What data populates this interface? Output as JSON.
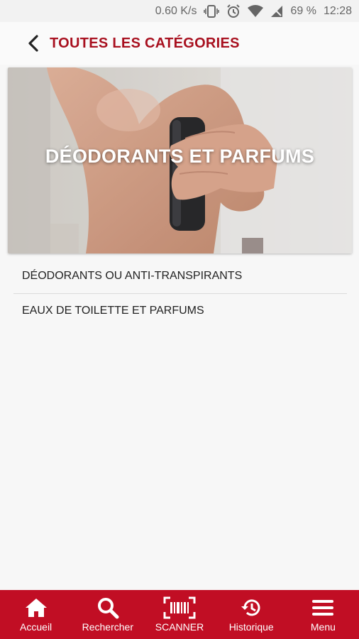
{
  "status_bar": {
    "speed": "0.60 K/s",
    "battery": "69 %",
    "time": "12:28",
    "icons": [
      "vibrate-icon",
      "alarm-icon",
      "wifi-icon",
      "signal-icon"
    ]
  },
  "header": {
    "back_icon": "chevron-left-icon",
    "title": "TOUTES LES CATÉGORIES"
  },
  "hero": {
    "title": "DÉODORANTS ET PARFUMS"
  },
  "list": {
    "items": [
      {
        "label": "DÉODORANTS OU ANTI-TRANSPIRANTS"
      },
      {
        "label": "EAUX DE TOILETTE ET PARFUMS"
      }
    ]
  },
  "bottom_nav": {
    "items": [
      {
        "label": "Accueil",
        "icon": "home-icon"
      },
      {
        "label": "Rechercher",
        "icon": "search-icon"
      },
      {
        "label": "SCANNER",
        "icon": "barcode-scanner-icon"
      },
      {
        "label": "Historique",
        "icon": "history-icon"
      },
      {
        "label": "Menu",
        "icon": "menu-icon"
      }
    ]
  },
  "colors": {
    "accent": "#a8101f",
    "nav_background": "#c10e24",
    "background": "#f7f7f7"
  }
}
